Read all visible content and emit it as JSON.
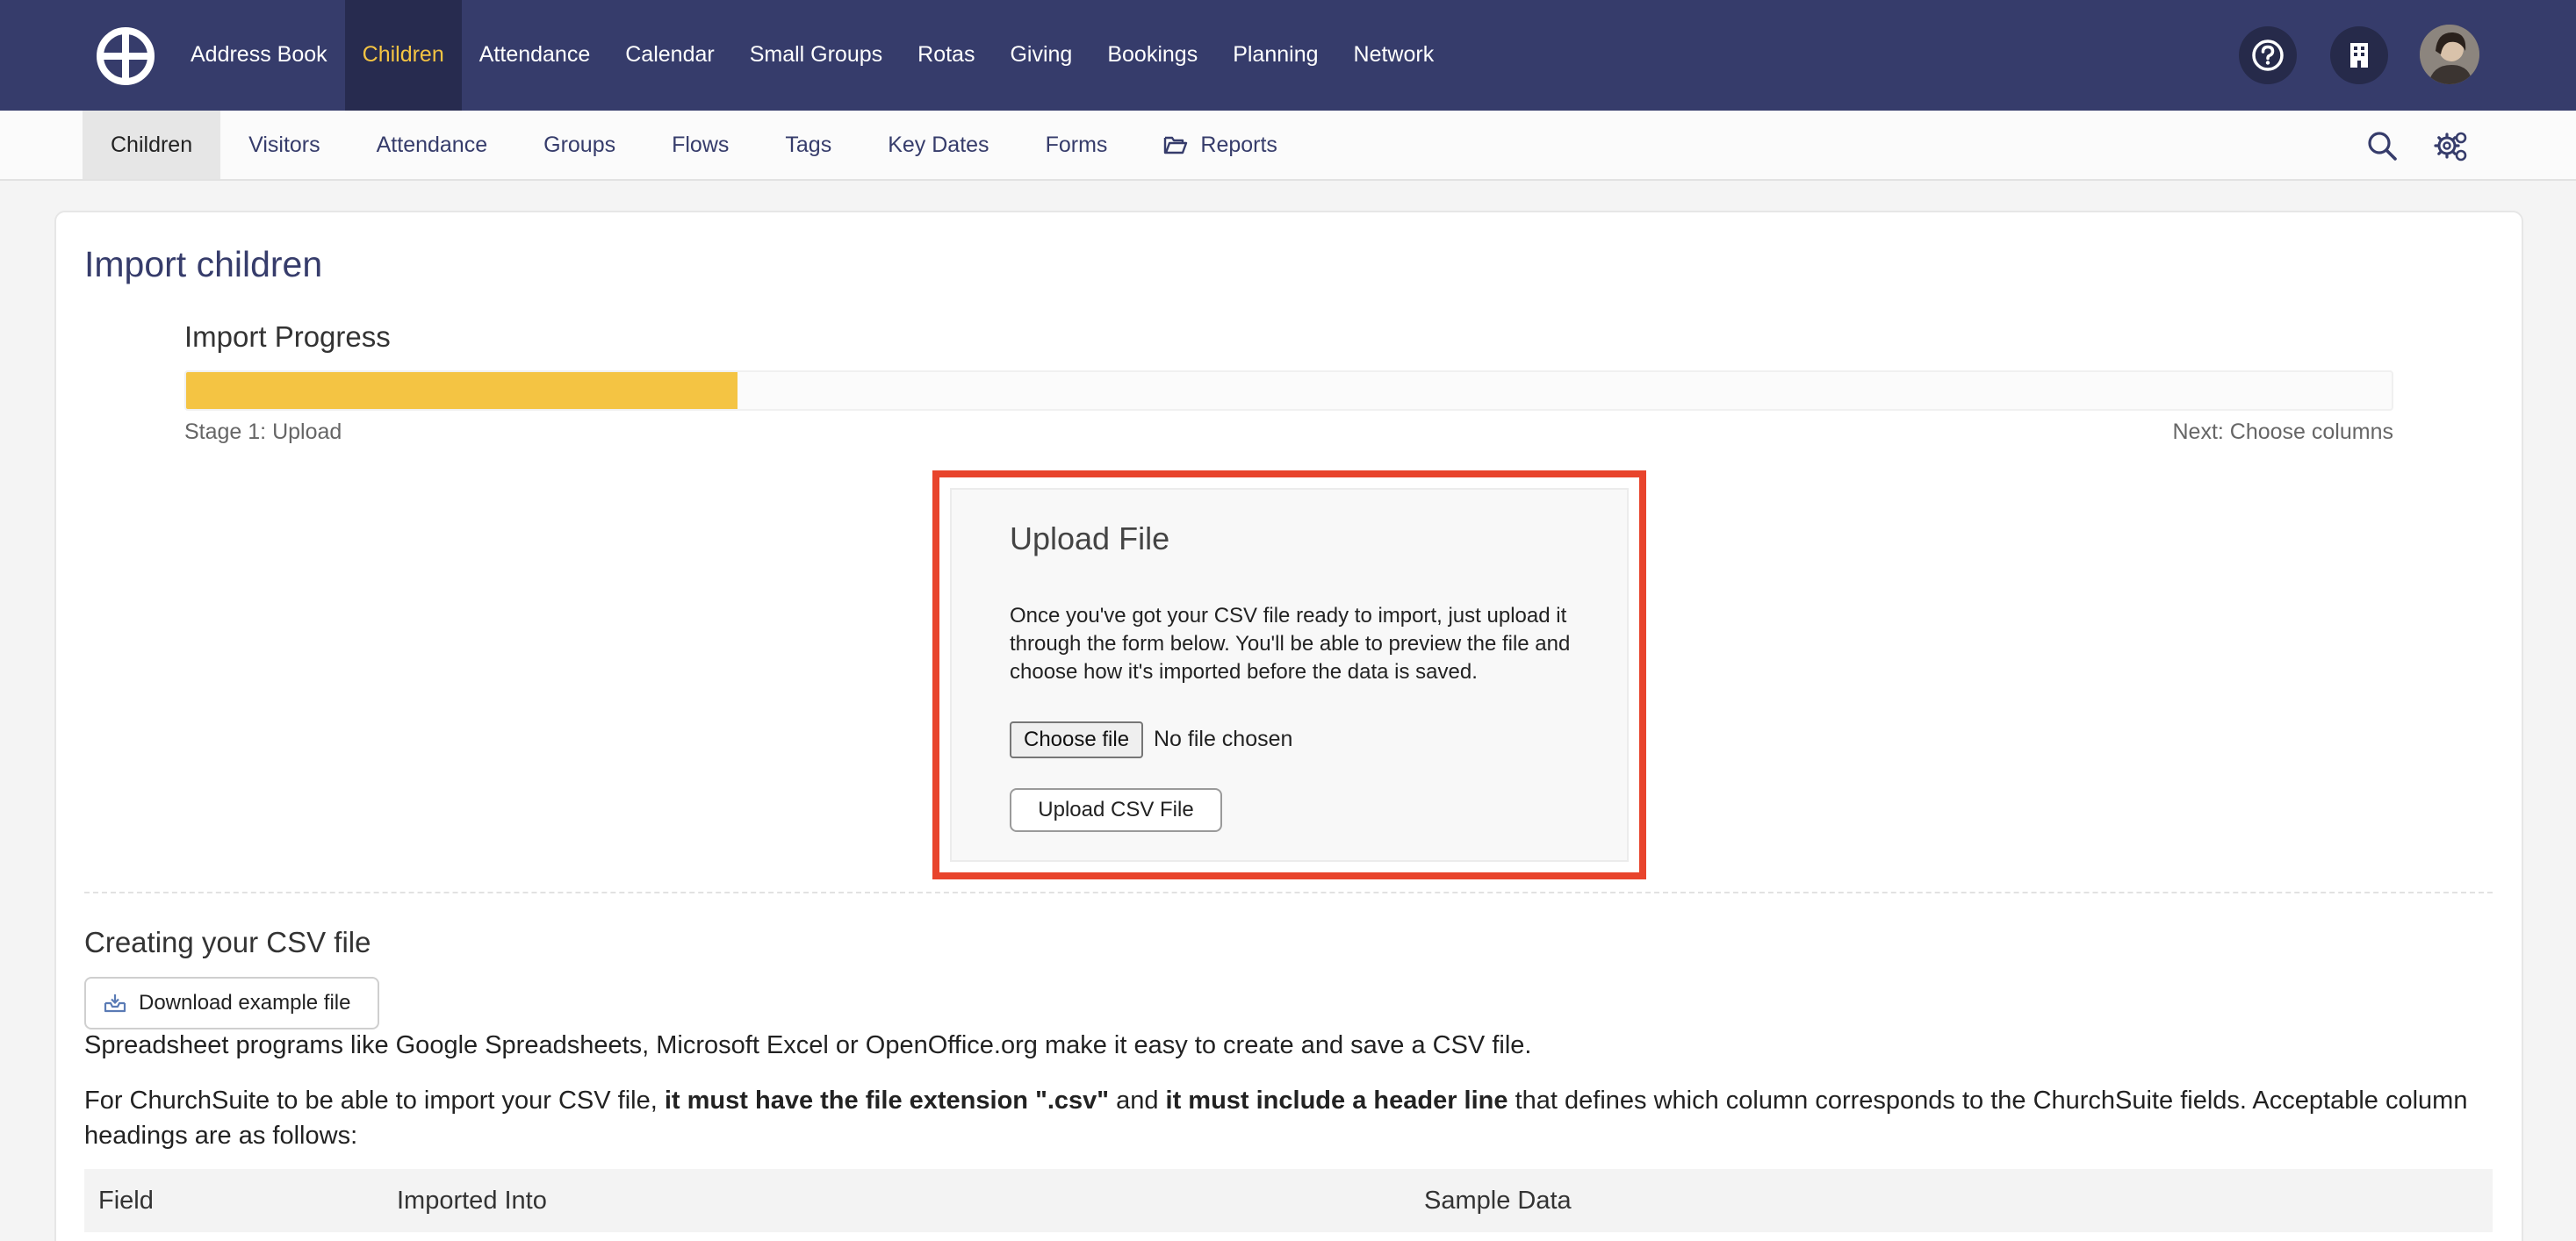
{
  "top_nav": {
    "items": [
      "Address Book",
      "Children",
      "Attendance",
      "Calendar",
      "Small Groups",
      "Rotas",
      "Giving",
      "Bookings",
      "Planning",
      "Network"
    ],
    "active_index": 1
  },
  "sub_nav": {
    "items": [
      "Children",
      "Visitors",
      "Attendance",
      "Groups",
      "Flows",
      "Tags",
      "Key Dates",
      "Forms",
      "Reports"
    ],
    "active_index": 0
  },
  "page": {
    "title": "Import children"
  },
  "progress": {
    "title": "Import Progress",
    "percent": 25,
    "stage_label": "Stage 1: Upload",
    "next_label": "Next: Choose columns"
  },
  "upload": {
    "title": "Upload File",
    "description": "Once you've got your CSV file ready to import, just upload it through the form below. You'll be able to preview the file and choose how it's imported before the data is saved.",
    "choose_file_label": "Choose file",
    "no_file_text": "No file chosen",
    "submit_label": "Upload CSV File"
  },
  "csv_help": {
    "heading": "Creating your CSV file",
    "download_label": "Download example file",
    "paragraph1": "Spreadsheet programs like Google Spreadsheets, Microsoft Excel or OpenOffice.org make it easy to create and save a CSV file.",
    "paragraph2_a": "For ChurchSuite to be able to import your CSV file, ",
    "paragraph2_b": "it must have the file extension \".csv\"",
    "paragraph2_c": " and ",
    "paragraph2_d": "it must include a header line",
    "paragraph2_e": " that defines which column corresponds to the ChurchSuite fields. Acceptable column headings are as follows:"
  },
  "table": {
    "headers": [
      "Field",
      "Imported Into",
      "Sample Data"
    ]
  },
  "colors": {
    "nav_bg": "#363c6b",
    "accent": "#f4c443",
    "highlight_outline": "#e8442c"
  },
  "icons": {
    "logo": "churchsuite-logo",
    "help": "question-circle-icon",
    "org": "building-icon",
    "search": "search-icon",
    "settings": "gear-icon",
    "reports": "folder-open-icon",
    "download": "download-icon"
  }
}
